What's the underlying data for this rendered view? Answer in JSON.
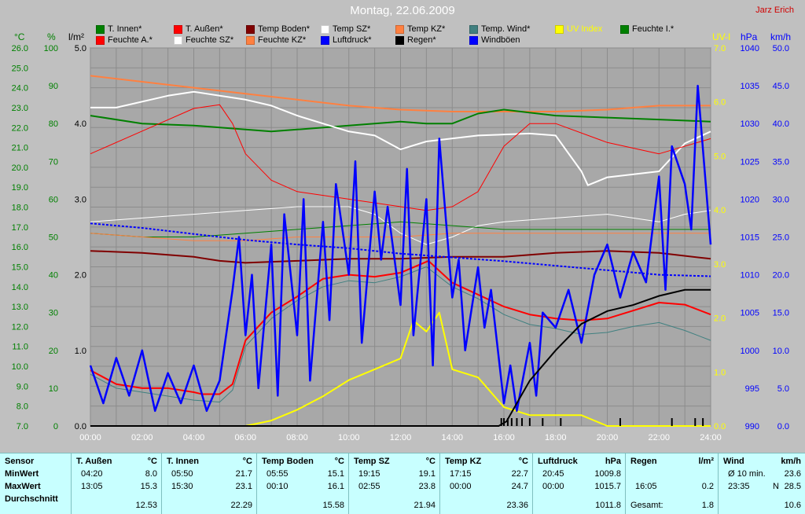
{
  "title": "Montag, 22.06.2009",
  "author": "Jarz Erich",
  "axis_units": {
    "temp": "°C",
    "hum": "%",
    "rain": "l/m²",
    "uv": "UV-I",
    "press": "hPa",
    "wind": "km/h"
  },
  "legend": [
    {
      "label": "T. Innen*",
      "color": "#008000"
    },
    {
      "label": "T. Außen*",
      "color": "#ff0000"
    },
    {
      "label": "Temp Boden*",
      "color": "#800000"
    },
    {
      "label": "Temp SZ*",
      "color": "#ffffff"
    },
    {
      "label": "Temp KZ*",
      "color": "#ff8040"
    },
    {
      "label": "Temp. Wind*",
      "color": "#408080"
    },
    {
      "label": "UV Index",
      "color": "#ffff00"
    },
    {
      "label": "Feuchte I.*",
      "color": "#008000"
    },
    {
      "label": "Feuchte A.*",
      "color": "#ff0000"
    },
    {
      "label": "Feuchte SZ*",
      "color": "#ffffff"
    },
    {
      "label": "Feuchte KZ*",
      "color": "#ff8040"
    },
    {
      "label": "Luftdruck*",
      "color": "#0000ff"
    },
    {
      "label": "Regen*",
      "color": "#000000"
    },
    {
      "label": "Windböen",
      "color": "#0000ff"
    }
  ],
  "chart_data": {
    "type": "line",
    "title": "Montag, 22.06.2009",
    "x_ticks": [
      "00:00",
      "02:00",
      "04:00",
      "06:00",
      "08:00",
      "10:00",
      "12:00",
      "14:00",
      "16:00",
      "18:00",
      "20:00",
      "22:00",
      "24:00"
    ],
    "axes": {
      "temp": {
        "label": "°C",
        "range": [
          7.0,
          26.0
        ],
        "ticks": [
          "26.0",
          "25.0",
          "24.0",
          "23.0",
          "22.0",
          "21.0",
          "20.0",
          "19.0",
          "18.0",
          "17.0",
          "16.0",
          "15.0",
          "14.0",
          "13.0",
          "12.0",
          "11.0",
          "10.0",
          "9.0",
          "8.0",
          "7.0"
        ]
      },
      "hum": {
        "label": "%",
        "range": [
          0,
          100
        ],
        "ticks": [
          "100",
          "90",
          "80",
          "70",
          "60",
          "50",
          "40",
          "30",
          "20",
          "10",
          "0"
        ]
      },
      "rain": {
        "label": "l/m²",
        "range": [
          0.0,
          5.0
        ],
        "ticks": [
          "5.0",
          "4.0",
          "3.0",
          "2.0",
          "1.0",
          "0.0"
        ]
      },
      "uv": {
        "label": "UV-I",
        "range": [
          0.0,
          7.0
        ],
        "ticks": [
          "7.0",
          "6.0",
          "5.0",
          "4.0",
          "3.0",
          "2.0",
          "1.0",
          "0.0"
        ]
      },
      "press": {
        "label": "hPa",
        "range": [
          990,
          1040
        ],
        "ticks": [
          "1040",
          "1035",
          "1030",
          "1025",
          "1020",
          "1015",
          "1010",
          "1005",
          "1000",
          "995",
          "990"
        ]
      },
      "wind": {
        "label": "km/h",
        "range": [
          0.0,
          50.0
        ],
        "ticks": [
          "50.0",
          "45.0",
          "40.0",
          "35.0",
          "30.0",
          "25.0",
          "20.0",
          "15.0",
          "10.0",
          "5.0",
          "0.0"
        ]
      }
    },
    "series": [
      {
        "name": "Temp KZ*",
        "color": "#ff8040",
        "axis": "temp",
        "x": [
          0,
          2,
          4,
          6,
          8,
          10,
          12,
          14,
          16,
          18,
          20,
          22,
          24
        ],
        "values": [
          24.6,
          24.3,
          24.0,
          23.7,
          23.4,
          23.1,
          22.9,
          22.8,
          22.8,
          22.8,
          22.9,
          23.1,
          23.1
        ]
      },
      {
        "name": "T. Innen*",
        "color": "#008000",
        "axis": "temp",
        "x": [
          0,
          2,
          4,
          6,
          7,
          8,
          10,
          12,
          13,
          14,
          15,
          16,
          18,
          20,
          22,
          24
        ],
        "values": [
          22.6,
          22.2,
          22.1,
          21.9,
          21.8,
          21.9,
          22.1,
          22.3,
          22.2,
          22.2,
          22.7,
          22.9,
          22.6,
          22.5,
          22.4,
          22.3
        ]
      },
      {
        "name": "Temp SZ*",
        "color": "#ffffff",
        "axis": "temp",
        "x": [
          0,
          1,
          3,
          4,
          6,
          7,
          8,
          10,
          11,
          12,
          13,
          15,
          17,
          18,
          19,
          19.25,
          20,
          22,
          23,
          24
        ],
        "values": [
          23.0,
          23.0,
          23.6,
          23.8,
          23.4,
          23.1,
          22.6,
          21.8,
          21.6,
          20.9,
          21.3,
          21.6,
          21.7,
          21.6,
          19.8,
          19.1,
          19.5,
          19.8,
          21.2,
          21.8
        ]
      },
      {
        "name": "Temp Boden*",
        "color": "#800000",
        "axis": "temp",
        "x": [
          0,
          2,
          4,
          5,
          6,
          8,
          10,
          12,
          14,
          16,
          18,
          20,
          22,
          24
        ],
        "values": [
          15.8,
          15.7,
          15.5,
          15.3,
          15.2,
          15.3,
          15.4,
          15.4,
          15.5,
          15.5,
          15.7,
          15.8,
          15.7,
          15.4
        ]
      },
      {
        "name": "T. Außen*",
        "color": "#ff0000",
        "axis": "temp",
        "x": [
          0,
          1,
          2,
          3,
          4,
          4.33,
          5,
          5.5,
          6,
          7,
          8,
          9,
          10,
          11,
          12,
          13.08,
          14,
          15,
          16,
          17,
          18,
          19,
          20,
          21,
          22,
          23,
          24
        ],
        "values": [
          9.8,
          9.1,
          8.9,
          8.9,
          8.7,
          8.6,
          8.6,
          9.1,
          11.3,
          12.7,
          13.5,
          14.4,
          14.6,
          14.5,
          14.7,
          15.3,
          14.2,
          13.6,
          13.0,
          12.6,
          12.4,
          12.3,
          12.4,
          12.8,
          13.2,
          13.1,
          12.6
        ]
      },
      {
        "name": "Feuchte A.*",
        "color": "#ff0000",
        "axis": "hum",
        "x": [
          0,
          2,
          4,
          5,
          5.5,
          6,
          7,
          8,
          10,
          12,
          13,
          14,
          15,
          16,
          17,
          18,
          20,
          22,
          24
        ],
        "values": [
          72,
          78,
          84,
          85,
          80,
          72,
          65,
          62,
          60,
          58,
          57,
          58,
          62,
          74,
          80,
          80,
          75,
          72,
          76
        ]
      },
      {
        "name": "Feuchte SZ*",
        "color": "#ffffff",
        "axis": "hum",
        "x": [
          0,
          2,
          4,
          6,
          8,
          10,
          11,
          12,
          13,
          14,
          15,
          16,
          18,
          20,
          21,
          22,
          23,
          24
        ],
        "values": [
          54,
          55,
          56,
          57,
          58,
          58,
          56,
          51,
          48,
          50,
          53,
          54,
          55,
          56,
          55,
          54,
          56,
          57
        ]
      },
      {
        "name": "Feuchte I.*",
        "color": "#008000",
        "axis": "hum",
        "x": [
          0,
          2,
          4,
          6,
          8,
          10,
          12,
          14,
          16,
          18,
          20,
          22,
          24
        ],
        "values": [
          51,
          50,
          50,
          51,
          52,
          53,
          54,
          53,
          52,
          52,
          52,
          52,
          52
        ]
      },
      {
        "name": "Feuchte KZ*",
        "color": "#ff8040",
        "axis": "hum",
        "x": [
          0,
          2,
          4,
          6,
          8,
          10,
          12,
          14,
          16,
          18,
          20,
          22,
          24
        ],
        "values": [
          51,
          50,
          49,
          49,
          50,
          50,
          50,
          51,
          51,
          51,
          51,
          51,
          51
        ]
      },
      {
        "name": "Temp. Wind*",
        "color": "#408080",
        "axis": "temp",
        "x": [
          0,
          1,
          2,
          3,
          4,
          5,
          5.5,
          6,
          7,
          8,
          9,
          10,
          11,
          12,
          13,
          14,
          15,
          16,
          17,
          18,
          19,
          20,
          21,
          22,
          23,
          24
        ],
        "values": [
          9.6,
          8.9,
          8.7,
          8.5,
          8.3,
          8.2,
          8.8,
          11.0,
          12.4,
          13.3,
          14.0,
          14.3,
          14.2,
          14.5,
          15.0,
          14.0,
          13.4,
          12.6,
          12.1,
          11.9,
          11.6,
          11.7,
          12.0,
          12.2,
          11.8,
          11.3
        ]
      },
      {
        "name": "Luftdruck*",
        "color": "#0000ff",
        "axis": "press",
        "dashed": true,
        "x": [
          0,
          2,
          4,
          6,
          8,
          10,
          12,
          14,
          16,
          18,
          20,
          22,
          24
        ],
        "values": [
          1016.8,
          1016.2,
          1015.4,
          1014.6,
          1014.0,
          1013.5,
          1012.8,
          1012.3,
          1011.8,
          1011.2,
          1010.6,
          1010.0,
          1009.8
        ]
      },
      {
        "name": "Regen*",
        "color": "#000000",
        "axis": "rain",
        "x": [
          0,
          15.8,
          16.1,
          16.5,
          17,
          18,
          19,
          20,
          21,
          22,
          23,
          24
        ],
        "values": [
          0,
          0,
          0.06,
          0.3,
          0.6,
          1.0,
          1.35,
          1.52,
          1.6,
          1.72,
          1.8,
          1.8
        ]
      },
      {
        "name": "UV Index",
        "color": "#ffff00",
        "axis": "uv",
        "x": [
          0,
          4,
          6,
          7,
          8,
          9,
          10,
          11,
          12,
          12.5,
          13,
          13.5,
          14,
          15,
          16,
          17,
          18,
          19,
          20,
          24
        ],
        "values": [
          0,
          0,
          0,
          0.1,
          0.3,
          0.55,
          0.85,
          1.05,
          1.25,
          1.95,
          1.75,
          2.1,
          1.05,
          0.9,
          0.35,
          0.2,
          0.2,
          0.2,
          0,
          0
        ]
      },
      {
        "name": "Windböen",
        "color": "#0000ff",
        "axis": "wind",
        "x": [
          0,
          0.5,
          1,
          1.5,
          2,
          2.5,
          3,
          3.5,
          4,
          4.5,
          5,
          5.5,
          5.75,
          6,
          6.25,
          6.5,
          7,
          7.25,
          7.5,
          8,
          8.25,
          8.5,
          9,
          9.25,
          9.5,
          10,
          10.25,
          10.5,
          11,
          11.25,
          11.5,
          12,
          12.25,
          12.5,
          13,
          13.25,
          13.5,
          14,
          14.25,
          14.5,
          15,
          15.25,
          15.5,
          16,
          16.25,
          16.5,
          17,
          17.25,
          17.5,
          18,
          18.5,
          19,
          19.5,
          20,
          20.5,
          21,
          21.5,
          22,
          22.25,
          22.5,
          23,
          23.25,
          23.5,
          24
        ],
        "values": [
          8,
          3,
          9,
          4,
          10,
          2,
          7,
          3,
          8,
          2,
          6,
          18,
          25,
          12,
          20,
          5,
          24,
          4,
          28,
          12,
          30,
          6,
          27,
          14,
          32,
          20,
          35,
          11,
          31,
          22,
          29,
          16,
          34,
          12,
          30,
          8,
          38,
          17,
          22,
          10,
          21,
          13,
          18,
          3,
          8,
          2,
          11,
          4,
          15,
          13,
          18,
          11,
          20,
          24,
          17,
          23,
          19,
          33,
          18,
          37,
          32,
          26,
          45,
          24
        ]
      }
    ]
  },
  "stats": {
    "sensor_header": "Sensor",
    "row_labels": [
      "MinWert",
      "MaxWert",
      "Durchschnitt"
    ],
    "columns": [
      {
        "name": "T. Außen",
        "unit": "°C",
        "min_time": "04:20",
        "min_val": "8.0",
        "max_time": "13:05",
        "max_val": "15.3",
        "avg": "12.53"
      },
      {
        "name": "T. Innen",
        "unit": "°C",
        "min_time": "05:50",
        "min_val": "21.7",
        "max_time": "15:30",
        "max_val": "23.1",
        "avg": "22.29"
      },
      {
        "name": "Temp Boden",
        "unit": "°C",
        "min_time": "05:55",
        "min_val": "15.1",
        "max_time": "00:10",
        "max_val": "16.1",
        "avg": "15.58"
      },
      {
        "name": "Temp SZ",
        "unit": "°C",
        "min_time": "19:15",
        "min_val": "19.1",
        "max_time": "02:55",
        "max_val": "23.8",
        "avg": "21.94"
      },
      {
        "name": "Temp KZ",
        "unit": "°C",
        "min_time": "17:15",
        "min_val": "22.7",
        "max_time": "00:00",
        "max_val": "24.7",
        "avg": "23.36"
      },
      {
        "name": "Luftdruck",
        "unit": "hPa",
        "min_time": "20:45",
        "min_val": "1009.8",
        "max_time": "00:00",
        "max_val": "1015.7",
        "avg": "1011.8"
      },
      {
        "name": "Regen",
        "unit": "l/m²",
        "min_time": "",
        "min_val": "",
        "max_time": "16:05",
        "max_val": "0.2",
        "avg_label": "Gesamt:",
        "avg": "1.8"
      },
      {
        "name": "Wind",
        "unit": "km/h",
        "min_time": "Ø 10 min.",
        "min_val": "23.6",
        "max_time": "23:35",
        "max_dir": "N",
        "max_val": "28.5",
        "avg": "10.6"
      }
    ]
  }
}
